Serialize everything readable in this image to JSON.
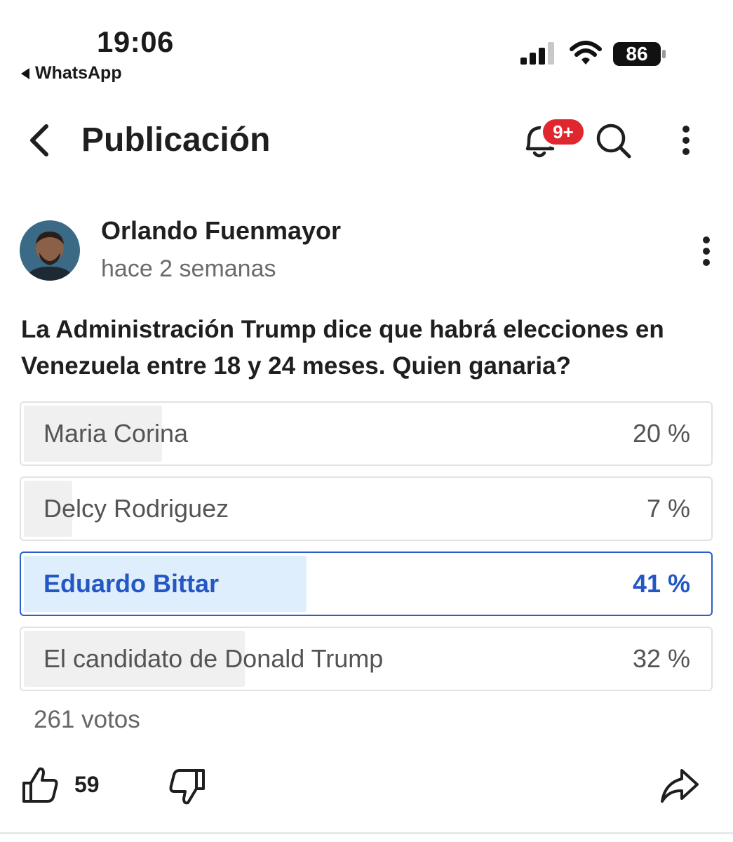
{
  "status_bar": {
    "time": "19:06",
    "back_app": "WhatsApp",
    "battery": "86",
    "icons": [
      "signal-icon",
      "wifi-icon",
      "battery-icon"
    ]
  },
  "header": {
    "title": "Publicación",
    "notification_badge": "9+",
    "icons": [
      "back-chevron-icon",
      "bell-icon",
      "search-icon",
      "more-vertical-icon"
    ]
  },
  "post": {
    "author": "Orlando Fuenmayor",
    "time": "hace 2 semanas",
    "question": "La Administración Trump dice que habrá elecciones en Venezuela entre 18 y 24 meses. Quien ganaria?"
  },
  "poll": {
    "options": [
      {
        "label": "Maria Corina",
        "pct_text": "20 %",
        "fraction": 0.2,
        "selected": false
      },
      {
        "label": "Delcy Rodriguez",
        "pct_text": "7 %",
        "fraction": 0.07,
        "selected": false
      },
      {
        "label": "Eduardo Bittar",
        "pct_text": "41 %",
        "fraction": 0.41,
        "selected": true
      },
      {
        "label": "El candidato de Donald Trump",
        "pct_text": "32 %",
        "fraction": 0.32,
        "selected": false
      }
    ],
    "votes_text": "261 votos",
    "selected_color": "#2456c4"
  },
  "actions": {
    "likes": "59",
    "icons": [
      "thumbs-up-icon",
      "thumbs-down-icon",
      "share-icon"
    ]
  }
}
